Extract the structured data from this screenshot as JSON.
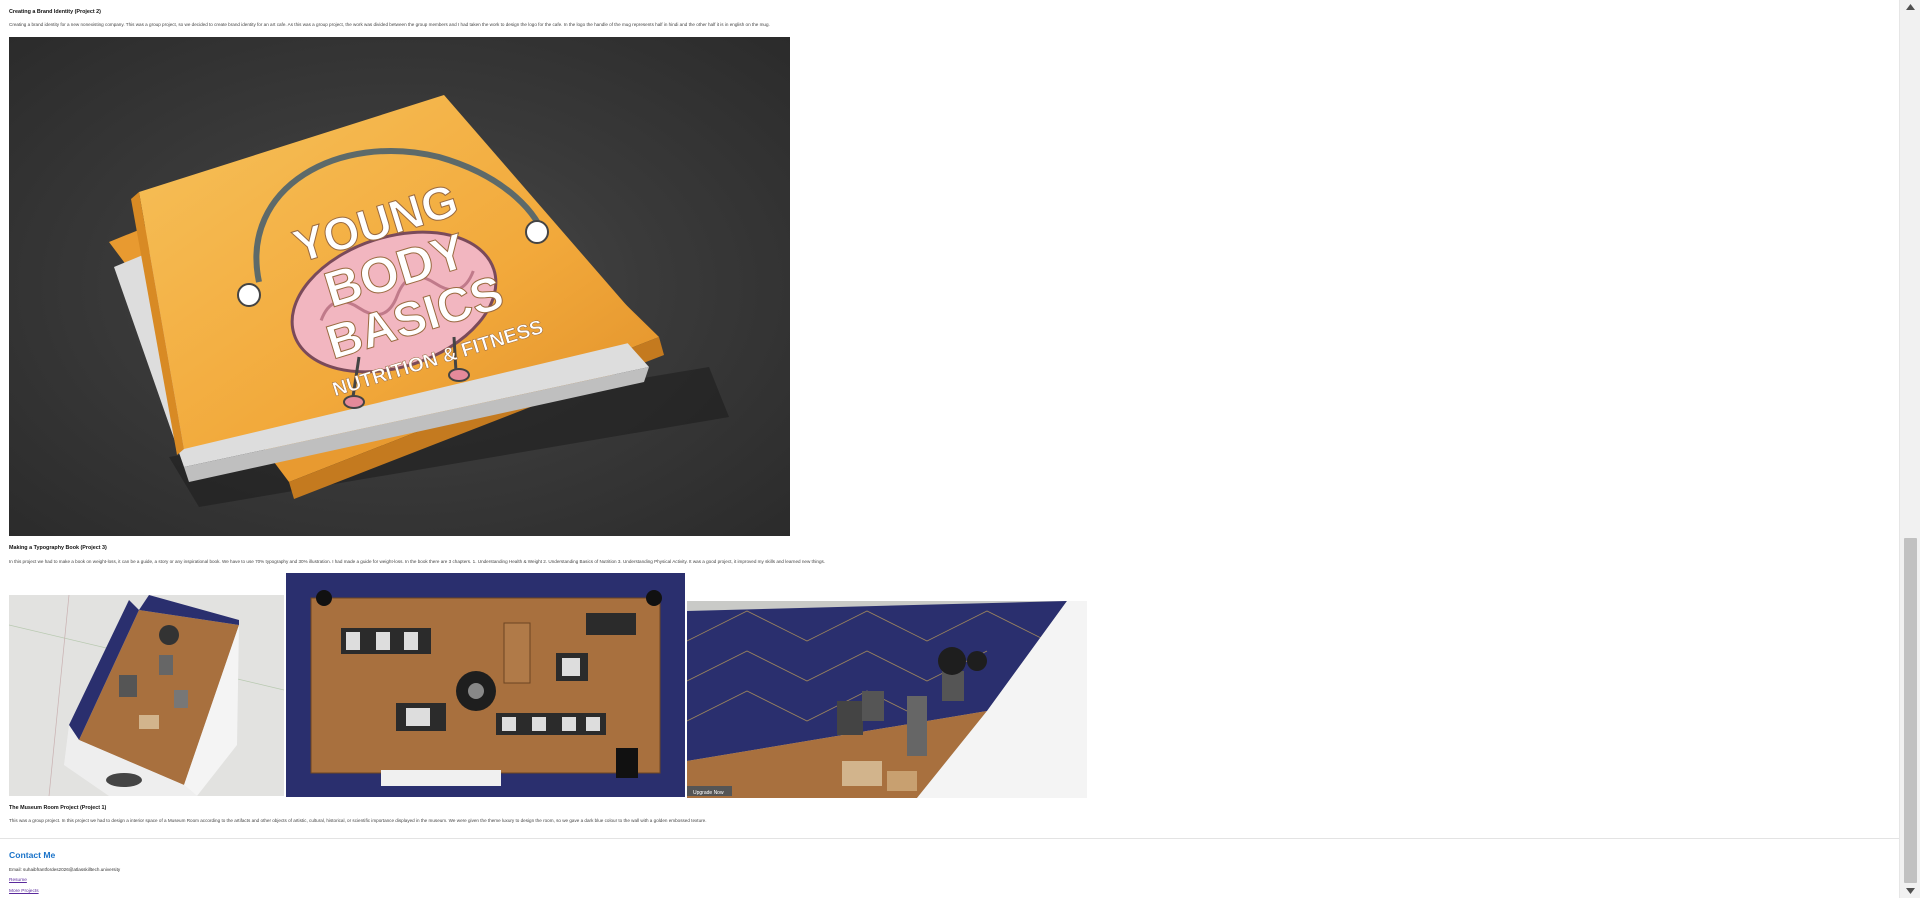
{
  "project2_brand": {
    "title": "Creating a Brand Identity (Project 2)",
    "description": "Creating a brand identity for a new nonexisting company. This was a group project, so we decided to create brand identity for an art cafe. As this was a group project, the work was divided between the group members and I had taken the work to design the logo for the cafe. In the logo the handle of the mug represents half in hindi and the other half it is in english on the mug."
  },
  "project3_book": {
    "title": "Making a Typography Book (Project 3)",
    "description": "In this project we had to make a book on weight-loss, it can be a guide, a story or any inspirational book. We have to use 70% typography and 30% illustration. I had made a guide for weight-loss. In the book there are 3 chapters. 1. Understanding Health & Weight 2. Understanding Basics of Nutrition 3. Understanding Physical Activity. It was a good project, it improved my skills and learned new things.",
    "book_cover": {
      "line1": "YOUNG",
      "line2": "BODY",
      "line3": "BASICS",
      "tagline": "NUTRITION & FITNESS"
    }
  },
  "project1_museum": {
    "title": "The Museum Room Project (Project 1)",
    "description": "This was a group project. In this project we had to design a interior space of a Museum Room according to the artifacts and other objects of artistic, cultural, historical, or scientific importance displayed in the museum. We were given the theme luxury to design the room, so we gave a dark blue colour to the wall with a golden embossed texture.",
    "watermark": "Upgrade Now"
  },
  "contact": {
    "title": "Contact Me",
    "email": "Email: suhaibfrantfordes2026@atlasskilltech.university",
    "resume_link": "Resume",
    "more_projects_link": "More Projects"
  },
  "colors": {
    "accent": "#1a73c9",
    "book_cover": "#f2a93b",
    "wall_blue": "#2a2f6e",
    "floor_wood": "#a8703e",
    "link_visited": "#5a2a9c"
  },
  "icons": {
    "scroll_up": "caret-up-icon",
    "scroll_down": "caret-down-icon"
  }
}
